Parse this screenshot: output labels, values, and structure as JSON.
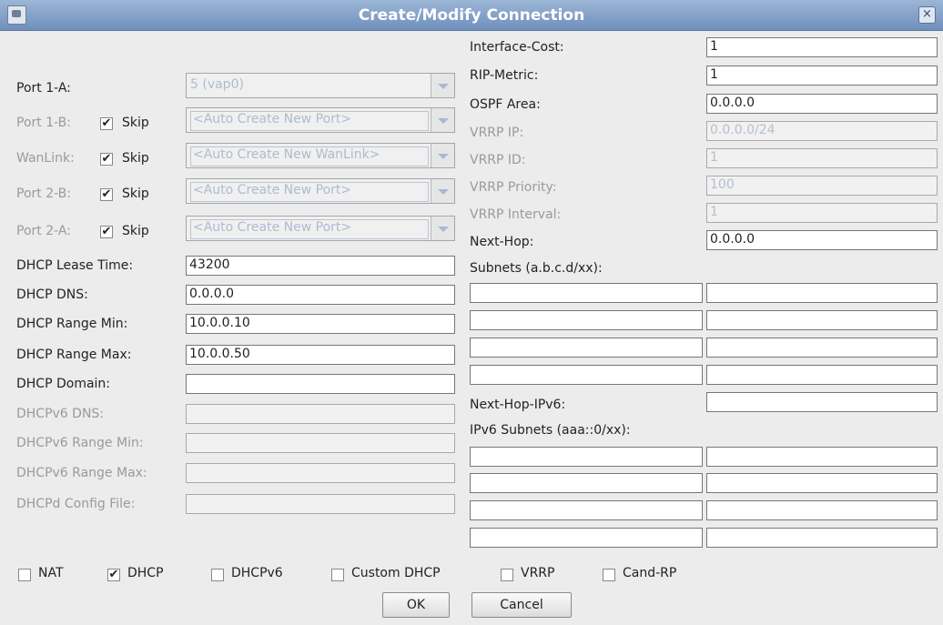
{
  "window": {
    "title": "Create/Modify Connection",
    "close_glyph": "×"
  },
  "left": {
    "port1a": {
      "label": "Port 1-A:",
      "value": "5 (vap0)"
    },
    "port1b": {
      "label": "Port 1-B:",
      "skip_label": "Skip",
      "skip_checked": true,
      "value": "<Auto Create New Port>"
    },
    "wanlink": {
      "label": "WanLink:",
      "skip_label": "Skip",
      "skip_checked": true,
      "value": "<Auto Create New WanLink>"
    },
    "port2b": {
      "label": "Port 2-B:",
      "skip_label": "Skip",
      "skip_checked": true,
      "value": "<Auto Create New Port>"
    },
    "port2a": {
      "label": "Port 2-A:",
      "skip_label": "Skip",
      "skip_checked": true,
      "value": "<Auto Create New Port>"
    },
    "dhcp_lease": {
      "label": "DHCP Lease Time:",
      "value": "43200"
    },
    "dhcp_dns": {
      "label": "DHCP DNS:",
      "value": "0.0.0.0"
    },
    "dhcp_min": {
      "label": "DHCP Range Min:",
      "value": "10.0.0.10"
    },
    "dhcp_max": {
      "label": "DHCP Range Max:",
      "value": "10.0.0.50"
    },
    "dhcp_domain": {
      "label": "DHCP Domain:",
      "value": ""
    },
    "dhcp6_dns": {
      "label": "DHCPv6 DNS:",
      "value": ""
    },
    "dhcp6_min": {
      "label": "DHCPv6 Range Min:",
      "value": ""
    },
    "dhcp6_max": {
      "label": "DHCPv6 Range Max:",
      "value": ""
    },
    "dhcpd_config": {
      "label": "DHCPd Config File:",
      "value": ""
    }
  },
  "right": {
    "interface_cost": {
      "label": "Interface-Cost:",
      "value": "1"
    },
    "rip_metric": {
      "label": "RIP-Metric:",
      "value": "1"
    },
    "ospf_area": {
      "label": "OSPF Area:",
      "value": "0.0.0.0"
    },
    "vrrp_ip": {
      "label": "VRRP IP:",
      "value": "0.0.0.0/24"
    },
    "vrrp_id": {
      "label": "VRRP ID:",
      "value": "1"
    },
    "vrrp_priority": {
      "label": "VRRP Priority:",
      "value": "100"
    },
    "vrrp_interval": {
      "label": "VRRP Interval:",
      "value": "1"
    },
    "next_hop": {
      "label": "Next-Hop:",
      "value": "0.0.0.0"
    },
    "subnets_label": "Subnets (a.b.c.d/xx):",
    "next_hop_ipv6": {
      "label": "Next-Hop-IPv6:",
      "value": ""
    },
    "ipv6_subnets_label": "IPv6 Subnets (aaa::0/xx):"
  },
  "options": {
    "nat": {
      "label": "NAT",
      "checked": false
    },
    "dhcp": {
      "label": "DHCP",
      "checked": true
    },
    "dhcpv6": {
      "label": "DHCPv6",
      "checked": false
    },
    "custom_dhcp": {
      "label": "Custom DHCP",
      "checked": false
    },
    "vrrp": {
      "label": "VRRP",
      "checked": false
    },
    "cand_rp": {
      "label": "Cand-RP",
      "checked": false
    }
  },
  "buttons": {
    "ok": "OK",
    "cancel": "Cancel"
  },
  "glyphs": {
    "check": "✔"
  }
}
